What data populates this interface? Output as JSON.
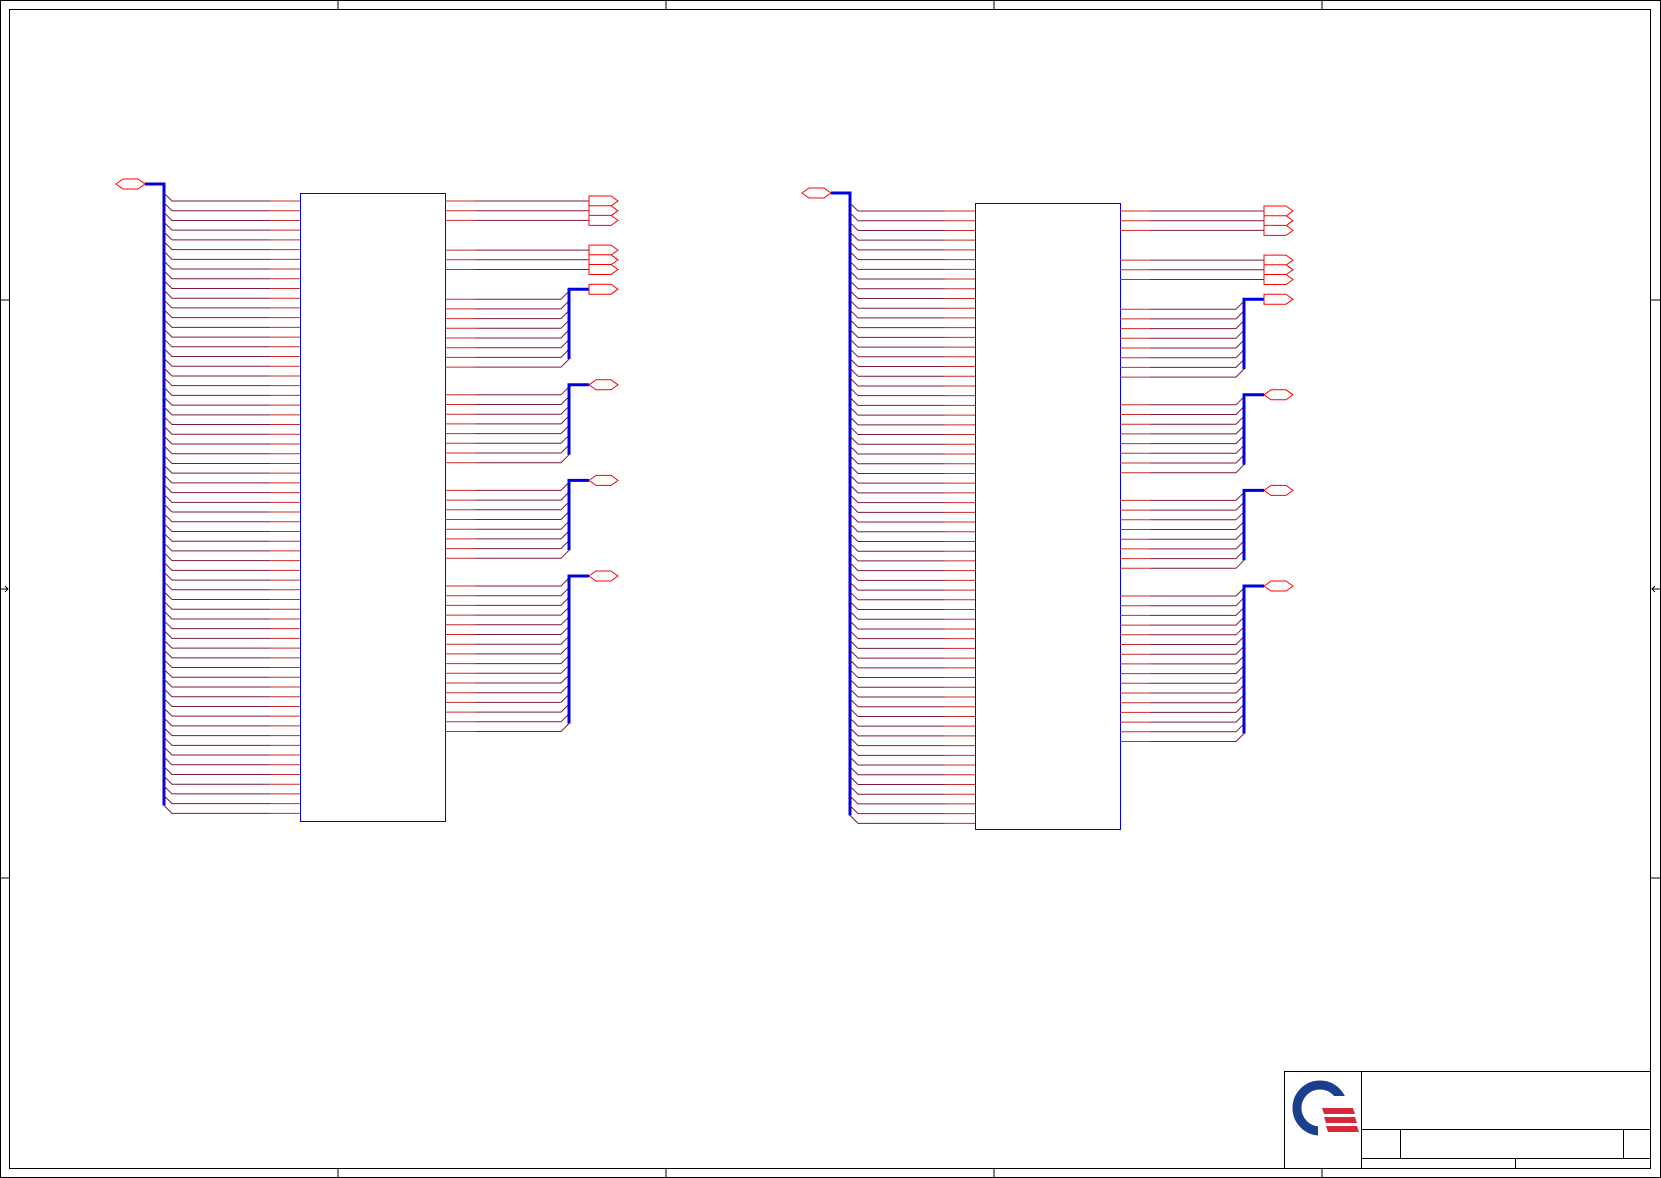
{
  "colors": {
    "border": "#000000",
    "wire": "#cc2a2a",
    "wire_dark": "#7a1a3a",
    "bus": "#0000e0",
    "part_outline": "#0000ff",
    "port": "#ff0000",
    "logo_blue": "#1b3f8f",
    "logo_red": "#d8283c"
  },
  "sheet": {
    "logo": "company-logo",
    "title_block": {
      "title": "",
      "document_number": "",
      "revision": "",
      "size": "",
      "date": "",
      "sheet": ""
    }
  },
  "symbols": [
    {
      "name": "left-component",
      "left_pin_count": 64,
      "right_groups": [
        {
          "port": "single",
          "pins": 1
        },
        {
          "port": "single",
          "pins": 1
        },
        {
          "port": "single",
          "pins": 1
        },
        {
          "port": "single",
          "pins": 1
        },
        {
          "port": "single",
          "pins": 1
        },
        {
          "port": "single",
          "pins": 1
        },
        {
          "port": "bus",
          "pins": 8
        },
        {
          "port": "bus",
          "pins": 8
        },
        {
          "port": "bus",
          "pins": 8
        },
        {
          "port": "bus",
          "pins": 16
        }
      ]
    },
    {
      "name": "right-component",
      "left_pin_count": 64,
      "right_groups": [
        {
          "port": "single",
          "pins": 1
        },
        {
          "port": "single",
          "pins": 1
        },
        {
          "port": "single",
          "pins": 1
        },
        {
          "port": "single",
          "pins": 1
        },
        {
          "port": "single",
          "pins": 1
        },
        {
          "port": "single",
          "pins": 1
        },
        {
          "port": "bus",
          "pins": 8
        },
        {
          "port": "bus",
          "pins": 8
        },
        {
          "port": "bus",
          "pins": 8
        },
        {
          "port": "bus",
          "pins": 16
        }
      ]
    }
  ]
}
